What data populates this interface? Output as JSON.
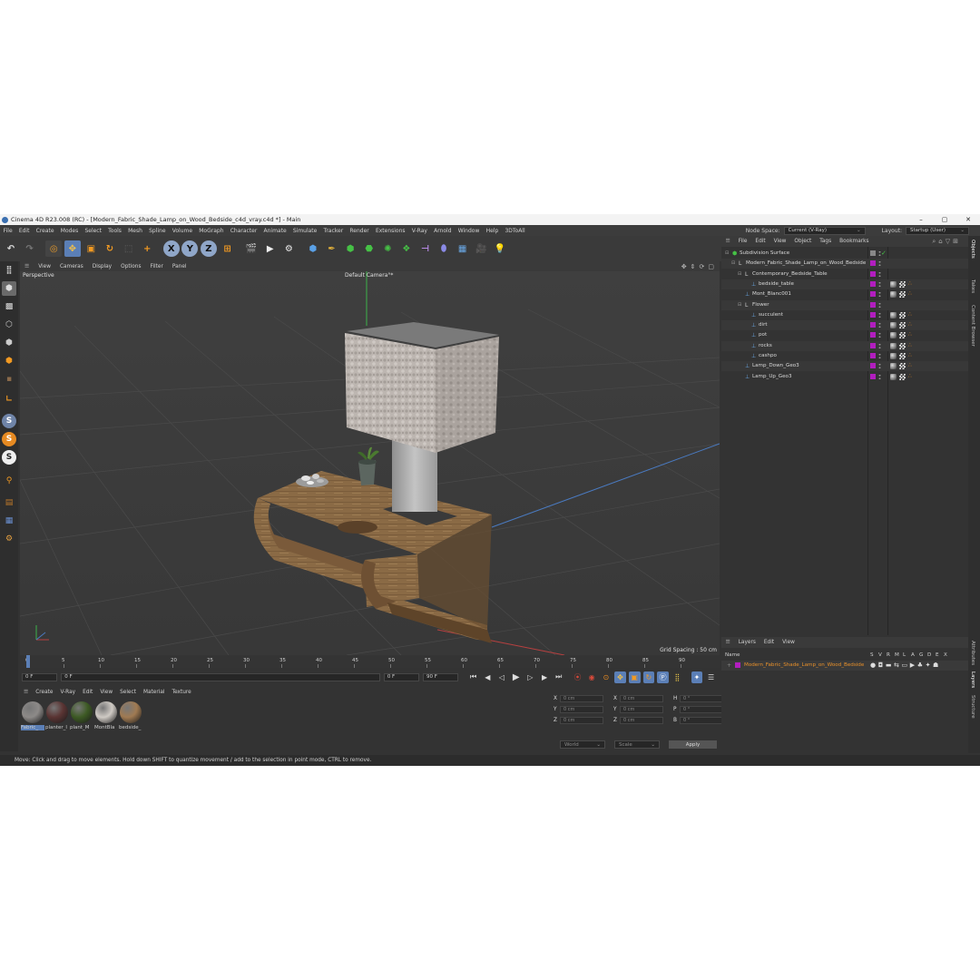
{
  "window": {
    "title": "Cinema 4D R23.008 (RC) - [Modern_Fabric_Shade_Lamp_on_Wood_Bedside_c4d_vray.c4d *] - Main",
    "minimize": "–",
    "maximize": "▢",
    "close": "✕"
  },
  "menubar": {
    "items": [
      "File",
      "Edit",
      "Create",
      "Modes",
      "Select",
      "Tools",
      "Mesh",
      "Spline",
      "Volume",
      "MoGraph",
      "Character",
      "Animate",
      "Simulate",
      "Tracker",
      "Render",
      "Extensions",
      "V-Ray",
      "Arnold",
      "Window",
      "Help",
      "3DToAll"
    ],
    "node_space_label": "Node Space:",
    "node_space_value": "Current (V-Ray)",
    "layout_label": "Layout:",
    "layout_value": "Startup (User)"
  },
  "toolbar": {
    "axis_x": "X",
    "axis_y": "Y",
    "axis_z": "Z"
  },
  "leftbar": {
    "s_label": "S"
  },
  "viewport": {
    "menu": [
      "View",
      "Cameras",
      "Display",
      "Options",
      "Filter",
      "Panel"
    ],
    "perspective_label": "Perspective",
    "camera_label": "Default Camera",
    "camera_suffix": "°*",
    "grid_spacing": "Grid Spacing : 50 cm"
  },
  "timeline": {
    "ticks": [
      "0",
      "5",
      "10",
      "15",
      "20",
      "25",
      "30",
      "35",
      "40",
      "45",
      "50",
      "55",
      "60",
      "65",
      "70",
      "75",
      "80",
      "85",
      "90"
    ],
    "current_frame_field": "0 F",
    "start_field": "0 F",
    "range_start": "0 F",
    "range_end": "90 F",
    "end_field": "90 F"
  },
  "materials": {
    "menu": [
      "Create",
      "V-Ray",
      "Edit",
      "View",
      "Select",
      "Material",
      "Texture"
    ],
    "items": [
      {
        "name": "Fabric_",
        "color": "#8d8a88"
      },
      {
        "name": "planter_l",
        "color": "#5a3433"
      },
      {
        "name": "plant_M",
        "color": "#3d5a24"
      },
      {
        "name": "MontBla",
        "color": "#cfcac4"
      },
      {
        "name": "bedside_",
        "color": "#a07a52"
      }
    ]
  },
  "coordinates": {
    "rows": [
      {
        "a1": "X",
        "v1": "0 cm",
        "a2": "X",
        "v2": "0 cm",
        "a3": "H",
        "v3": "0 °"
      },
      {
        "a1": "Y",
        "v1": "0 cm",
        "a2": "Y",
        "v2": "0 cm",
        "a3": "P",
        "v3": "0 °"
      },
      {
        "a1": "Z",
        "v1": "0 cm",
        "a2": "Z",
        "v2": "0 cm",
        "a3": "B",
        "v3": "0 °"
      }
    ],
    "space": "World",
    "mode": "Scale",
    "apply": "Apply"
  },
  "status": {
    "text": "Move: Click and drag to move elements. Hold down SHIFT to quantize movement / add to the selection in point mode, CTRL to remove."
  },
  "objects": {
    "menu": [
      "File",
      "Edit",
      "View",
      "Object",
      "Tags",
      "Bookmarks"
    ],
    "rows": [
      {
        "name": "Subdivision Surface",
        "indent": 0,
        "kind": "subd"
      },
      {
        "name": "Modern_Fabric_Shade_Lamp_on_Wood_Bedside",
        "indent": 1,
        "kind": "null"
      },
      {
        "name": "Contemporary_Bedside_Table",
        "indent": 2,
        "kind": "null"
      },
      {
        "name": "bedside_table",
        "indent": 3,
        "kind": "poly"
      },
      {
        "name": "Mont_Blanc001",
        "indent": 2,
        "kind": "poly"
      },
      {
        "name": "Flower",
        "indent": 2,
        "kind": "null"
      },
      {
        "name": "succulent",
        "indent": 3,
        "kind": "poly"
      },
      {
        "name": "dirt",
        "indent": 3,
        "kind": "poly"
      },
      {
        "name": "pot",
        "indent": 3,
        "kind": "poly"
      },
      {
        "name": "rocks",
        "indent": 3,
        "kind": "poly"
      },
      {
        "name": "cashpo",
        "indent": 3,
        "kind": "poly"
      },
      {
        "name": "Lamp_Down_Geo3",
        "indent": 2,
        "kind": "poly"
      },
      {
        "name": "Lamp_Up_Geo3",
        "indent": 2,
        "kind": "poly"
      }
    ]
  },
  "layers": {
    "menu": [
      "Layers",
      "Edit",
      "View"
    ],
    "name_header": "Name",
    "flags": [
      "S",
      "V",
      "R",
      "M",
      "L",
      "A",
      "G",
      "D",
      "E",
      "X"
    ],
    "row_name": "Modern_Fabric_Shade_Lamp_on_Wood_Bedside"
  },
  "sidetabs": [
    "Objects",
    "Takes",
    "Content Browser",
    "Attributes",
    "Layers",
    "Structure"
  ],
  "colors": {
    "accent": "#5b7fb6",
    "layer_color": "#b21ebf",
    "layer_text": "#e8902a"
  }
}
